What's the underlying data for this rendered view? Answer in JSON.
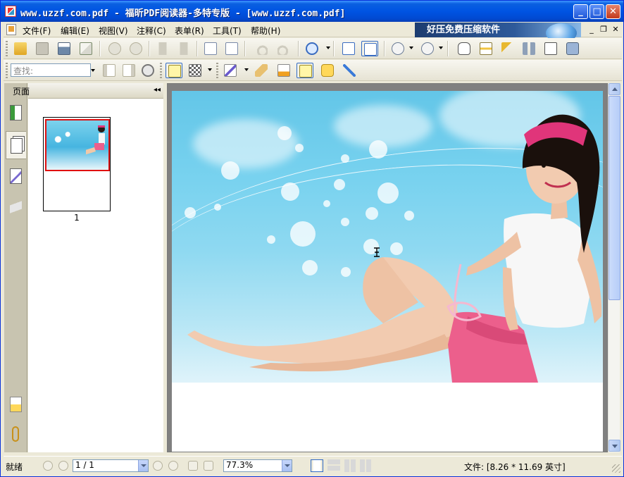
{
  "window": {
    "title": "www.uzzf.com.pdf - 福昕PDF阅读器-多特专版 - [www.uzzf.com.pdf]",
    "minimize": "_",
    "maximize": "□",
    "close": "✕"
  },
  "menu": {
    "items": [
      {
        "label": "文件(F)"
      },
      {
        "label": "编辑(E)"
      },
      {
        "label": "视图(V)"
      },
      {
        "label": "注释(C)"
      },
      {
        "label": "表单(R)"
      },
      {
        "label": "工具(T)"
      },
      {
        "label": "帮助(H)"
      }
    ],
    "banner": "好压免费压缩软件",
    "mdi_minimize": "_",
    "mdi_restore": "❐",
    "mdi_close": "✕"
  },
  "toolbar2": {
    "search_placeholder": "查找:"
  },
  "sidebar": {
    "panel_title": "页面",
    "collapse_icon": "◂◂",
    "thumbnails": [
      {
        "label": "1"
      }
    ]
  },
  "statusbar": {
    "status": "就绪",
    "page": "1 / 1",
    "zoom": "77.3%",
    "file_info": "文件: [8.26 * 11.69 英寸]"
  },
  "colors": {
    "titlebar": "#0054e3",
    "accent": "#316ac5",
    "chrome": "#ece9d8",
    "thumb_highlight": "#e01010"
  }
}
